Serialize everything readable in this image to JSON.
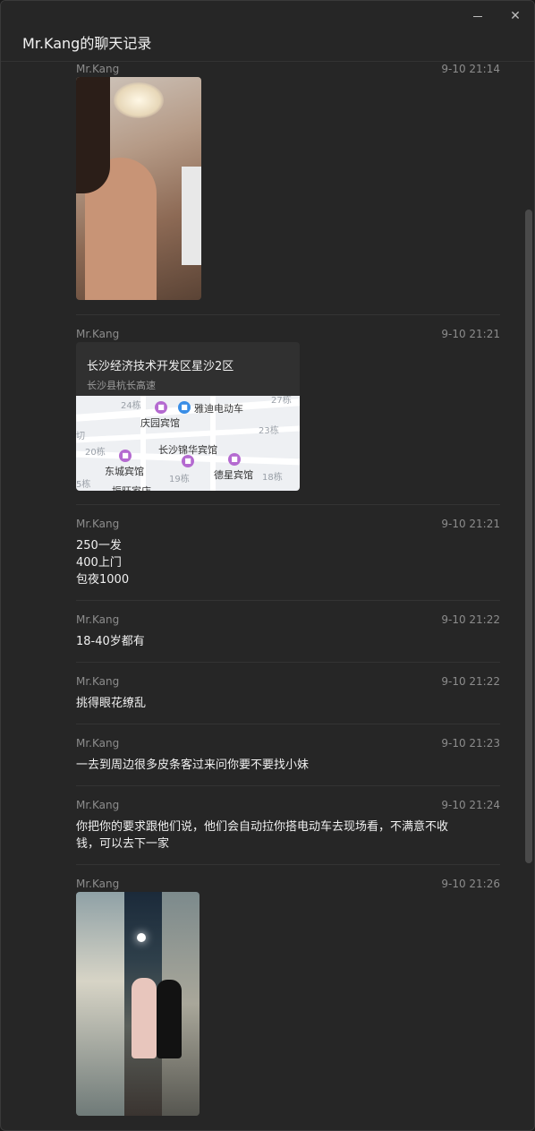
{
  "window": {
    "title": "Mr.Kang的聊天记录",
    "minimize": "minimize",
    "close": "close"
  },
  "messages": [
    {
      "sender": "Mr.Kang",
      "time": "9-10 21:14",
      "type": "image"
    },
    {
      "sender": "Mr.Kang",
      "time": "9-10 21:21",
      "type": "location",
      "location": {
        "title": "长沙经济技术开发区星沙2区",
        "subtitle": "长沙县杭长高速",
        "map_labels": [
          "24栋",
          "27栋",
          "23栋",
          "20栋",
          "19栋",
          "18栋",
          "5栋",
          "切"
        ],
        "map_pois": [
          "庆园宾馆",
          "雅迪电动车",
          "长沙锦华宾馆",
          "东城宾馆",
          "德星宾馆",
          "振旺家店"
        ]
      }
    },
    {
      "sender": "Mr.Kang",
      "time": "9-10 21:21",
      "type": "text",
      "lines": [
        "250一发",
        "400上门",
        "包夜1000"
      ]
    },
    {
      "sender": "Mr.Kang",
      "time": "9-10 21:22",
      "type": "text",
      "lines": [
        "18-40岁都有"
      ]
    },
    {
      "sender": "Mr.Kang",
      "time": "9-10 21:22",
      "type": "text",
      "lines": [
        "挑得眼花缭乱"
      ]
    },
    {
      "sender": "Mr.Kang",
      "time": "9-10 21:23",
      "type": "text",
      "lines": [
        "一去到周边很多皮条客过来问你要不要找小妹"
      ]
    },
    {
      "sender": "Mr.Kang",
      "time": "9-10 21:24",
      "type": "text",
      "lines": [
        "你把你的要求跟他们说，他们会自动拉你搭电动车去现场看，不满意不收",
        "钱，可以去下一家"
      ]
    },
    {
      "sender": "Mr.Kang",
      "time": "9-10 21:26",
      "type": "image"
    }
  ],
  "colors": {
    "background": "#262626",
    "meta_text": "#8c8c8c",
    "body_text": "#f0f0f0",
    "divider": "#343434"
  },
  "icons": {
    "minimize": "minimize-icon",
    "close": "close-icon",
    "hotel": "hotel-icon",
    "ebike": "ebike-icon"
  }
}
